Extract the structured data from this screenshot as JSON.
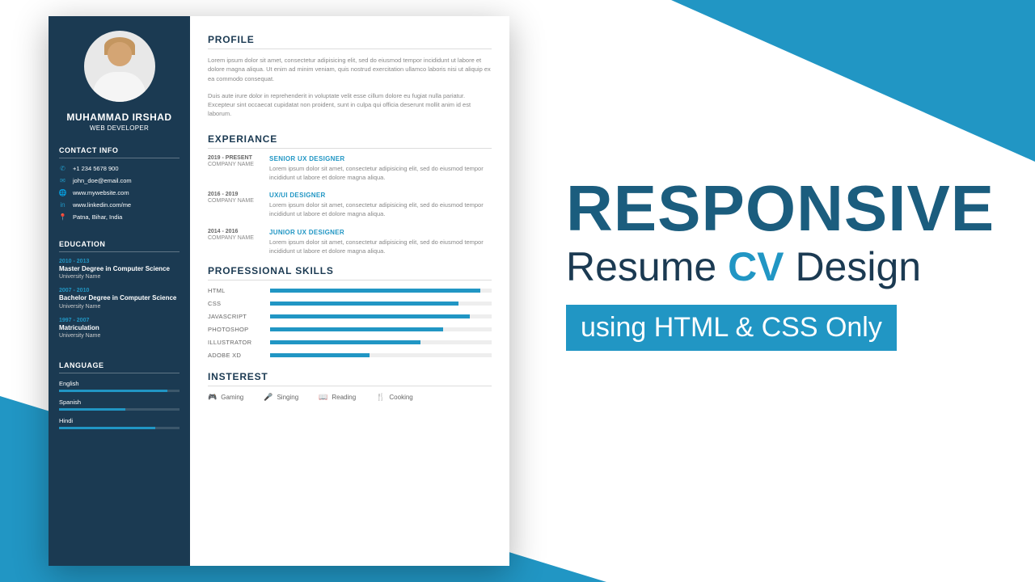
{
  "resume": {
    "name": "MUHAMMAD IRSHAD",
    "role": "WEB DEVELOPER",
    "contact_heading": "CONTACT INFO",
    "contacts": [
      {
        "icon": "phone",
        "text": "+1 234 5678 900"
      },
      {
        "icon": "mail",
        "text": "john_doe@email.com"
      },
      {
        "icon": "globe",
        "text": "www.mywebsite.com"
      },
      {
        "icon": "linkedin",
        "text": "www.linkedin.com/me"
      },
      {
        "icon": "pin",
        "text": "Patna, Bihar, India"
      }
    ],
    "education_heading": "EDUCATION",
    "education": [
      {
        "date": "2010 - 2013",
        "degree": "Master Degree in Computer Science",
        "uni": "University Name"
      },
      {
        "date": "2007 - 2010",
        "degree": "Bachelor Degree in Computer Science",
        "uni": "University Name"
      },
      {
        "date": "1997 - 2007",
        "degree": "Matriculation",
        "uni": "University Name"
      }
    ],
    "language_heading": "LANGUAGE",
    "languages": [
      {
        "name": "English",
        "pct": 90
      },
      {
        "name": "Spanish",
        "pct": 55
      },
      {
        "name": "Hindi",
        "pct": 80
      }
    ],
    "profile_heading": "PROFILE",
    "profile_p1": "Lorem ipsum dolor sit amet, consectetur adipisicing elit, sed do eiusmod tempor incididunt ut labore et dolore magna aliqua. Ut enim ad minim veniam, quis nostrud exercitation ullamco laboris nisi ut aliquip ex ea commodo consequat.",
    "profile_p2": "Duis aute irure dolor in reprehenderit in voluptate velit esse cillum dolore eu fugiat nulla pariatur. Excepteur sint occaecat cupidatat non proident, sunt in culpa qui officia deserunt mollit anim id est laborum.",
    "experience_heading": "EXPERIANCE",
    "experiance": [
      {
        "date": "2019 - PRESENT",
        "company": "COMPANY NAME",
        "title": "SENIOR UX DESIGNER",
        "desc": "Lorem ipsum dolor sit amet, consectetur adipisicing elit, sed do eiusmod tempor incididunt ut labore et dolore magna aliqua."
      },
      {
        "date": "2016 - 2019",
        "company": "COMPANY NAME",
        "title": "UX/UI DESIGNER",
        "desc": "Lorem ipsum dolor sit amet, consectetur adipisicing elit, sed do eiusmod tempor incididunt ut labore et dolore magna aliqua."
      },
      {
        "date": "2014 - 2016",
        "company": "COMPANY NAME",
        "title": "JUNIOR UX DESIGNER",
        "desc": "Lorem ipsum dolor sit amet, consectetur adipisicing elit, sed do eiusmod tempor incididunt ut labore et dolore magna aliqua."
      }
    ],
    "skills_heading": "PROFESSIONAL SKILLS",
    "skills": [
      {
        "name": "HTML",
        "pct": 95
      },
      {
        "name": "CSS",
        "pct": 85
      },
      {
        "name": "JAVASCRIPT",
        "pct": 90
      },
      {
        "name": "PHOTOSHOP",
        "pct": 78
      },
      {
        "name": "ILLUSTRATOR",
        "pct": 68
      },
      {
        "name": "ADOBE XD",
        "pct": 45
      }
    ],
    "interest_heading": "INSTEREST",
    "interests": [
      {
        "icon": "game",
        "text": "Gaming"
      },
      {
        "icon": "mic",
        "text": "Singing"
      },
      {
        "icon": "book",
        "text": "Reading"
      },
      {
        "icon": "cook",
        "text": "Cooking"
      }
    ]
  },
  "promo": {
    "l1": "RESPONSIVE",
    "l2a": "Resume ",
    "l2b": "CV",
    "l2c": " Design",
    "l3": "using HTML & CSS Only"
  }
}
